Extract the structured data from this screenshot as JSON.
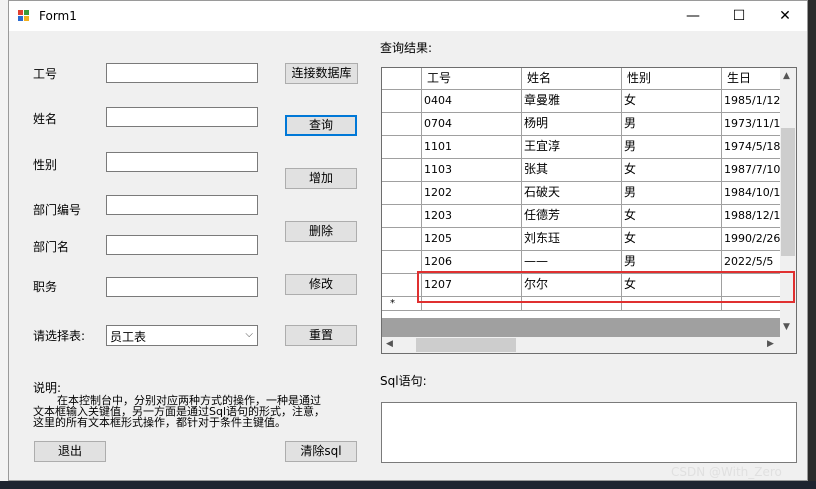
{
  "window": {
    "title": "Form1",
    "min_glyph": "—",
    "max_glyph": "☐",
    "close_glyph": "✕"
  },
  "form": {
    "labels": {
      "id": "工号",
      "name": "姓名",
      "gender": "性别",
      "dept_no": "部门编号",
      "dept_name": "部门名",
      "position": "职务",
      "choose_table": "请选择表:"
    },
    "fields": {
      "id": "",
      "name": "",
      "gender": "",
      "dept_no": "",
      "dept_name": "",
      "position": ""
    },
    "buttons": {
      "connect": "连接数据库",
      "query": "查询",
      "add": "增加",
      "delete": "删除",
      "modify": "修改",
      "reset": "重置",
      "exit": "退出",
      "clear_sql": "清除sql"
    },
    "table_select": {
      "value": "员工表"
    },
    "description": {
      "title": "说明:",
      "line1": "在本控制台中，分别对应两种方式的操作，一种是通过",
      "line2": "文本框输入关键值，另一方面是通过Sql语句的形式，注意，",
      "line3": "这里的所有文本框形式操作，都针对于条件主键值。"
    }
  },
  "results": {
    "label": "查询结果:",
    "columns": [
      "工号",
      "姓名",
      "性别",
      "生日"
    ],
    "rows": [
      [
        "0404",
        "章曼雅",
        "女",
        "1985/1/12"
      ],
      [
        "0704",
        "杨明",
        "男",
        "1973/11/1"
      ],
      [
        "1101",
        "王宜淳",
        "男",
        "1974/5/18"
      ],
      [
        "1103",
        "张其",
        "女",
        "1987/7/10"
      ],
      [
        "1202",
        "石破天",
        "男",
        "1984/10/1"
      ],
      [
        "1203",
        "任德芳",
        "女",
        "1988/12/1"
      ],
      [
        "1205",
        "刘东珏",
        "女",
        "1990/2/26"
      ],
      [
        "1206",
        "——",
        "男",
        "2022/5/5"
      ],
      [
        "1207",
        "尔尔",
        "女",
        ""
      ]
    ],
    "new_row_marker": "*"
  },
  "sql": {
    "label": "Sql语句:",
    "value": ""
  },
  "watermark": "CSDN @With_Zero",
  "colors": {
    "focus": "#0078d7",
    "highlight": "#e03030"
  }
}
